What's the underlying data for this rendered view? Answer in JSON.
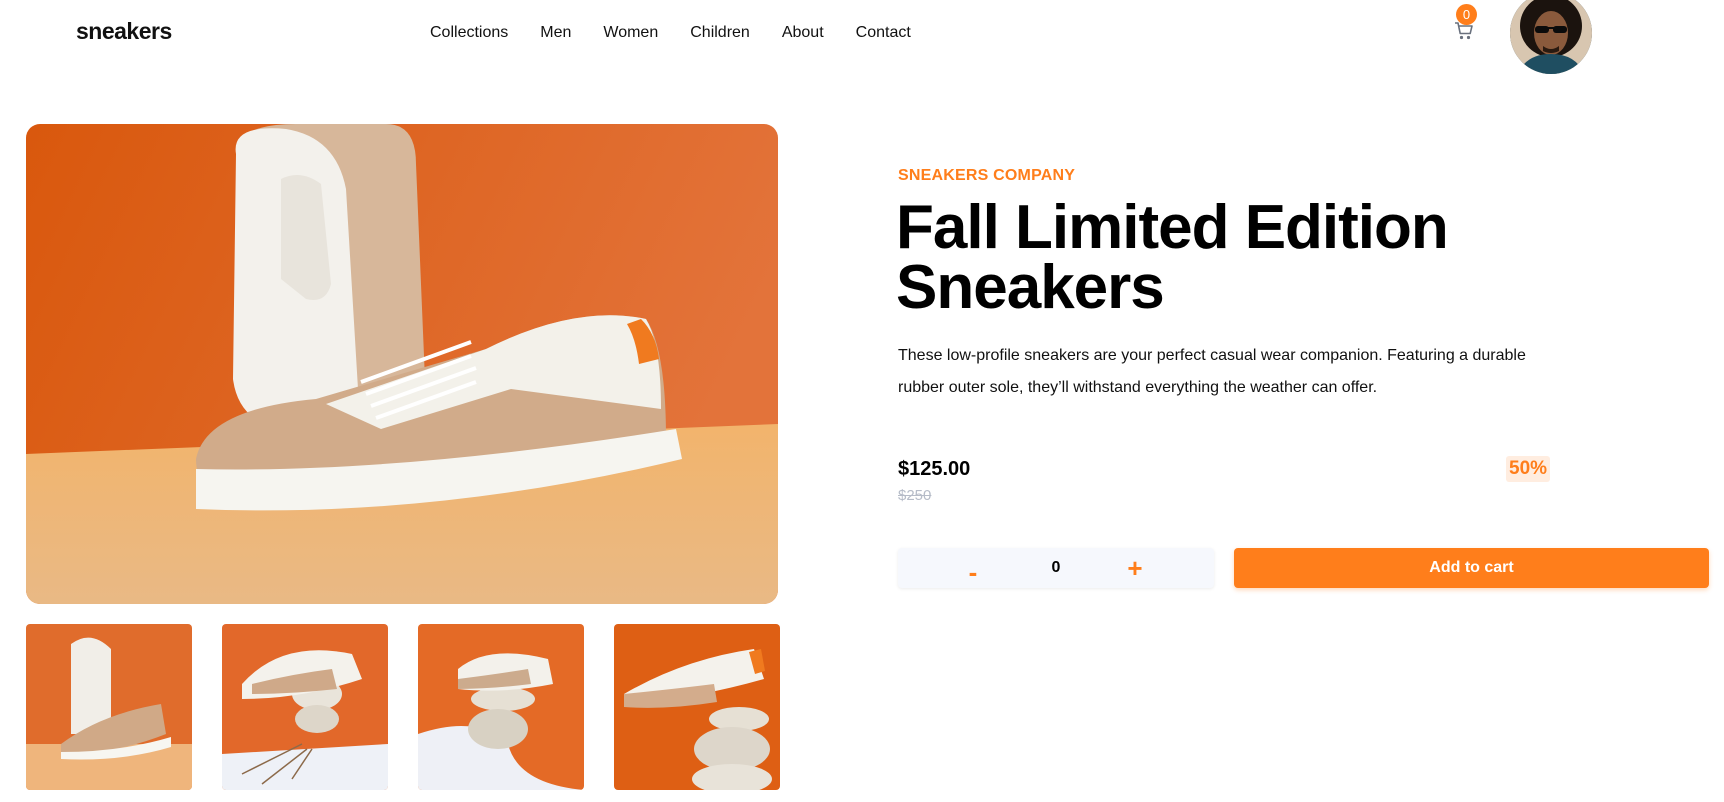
{
  "header": {
    "logo": "sneakers",
    "nav": [
      "Collections",
      "Men",
      "Women",
      "Children",
      "About",
      "Contact"
    ],
    "cart_count": "0",
    "icons": {
      "cart": "cart-icon",
      "avatar": "user-avatar"
    }
  },
  "product": {
    "company": "SNEAKERS COMPANY",
    "title": "Fall Limited Edition Sneakers",
    "description": "These low-profile sneakers are your perfect casual wear companion. Featuring a durable rubber outer sole, they’ll withstand everything the weather can offer.",
    "price": "$125.00",
    "old_price": "$250",
    "discount": "50%"
  },
  "cart_controls": {
    "minus": "-",
    "quantity": "0",
    "plus": "+",
    "add_label": "Add to cart"
  },
  "colors": {
    "accent": "#ff7e1b",
    "accent_pale": "#ffede0",
    "text": "#1d2025",
    "muted": "#b6bcc8"
  }
}
